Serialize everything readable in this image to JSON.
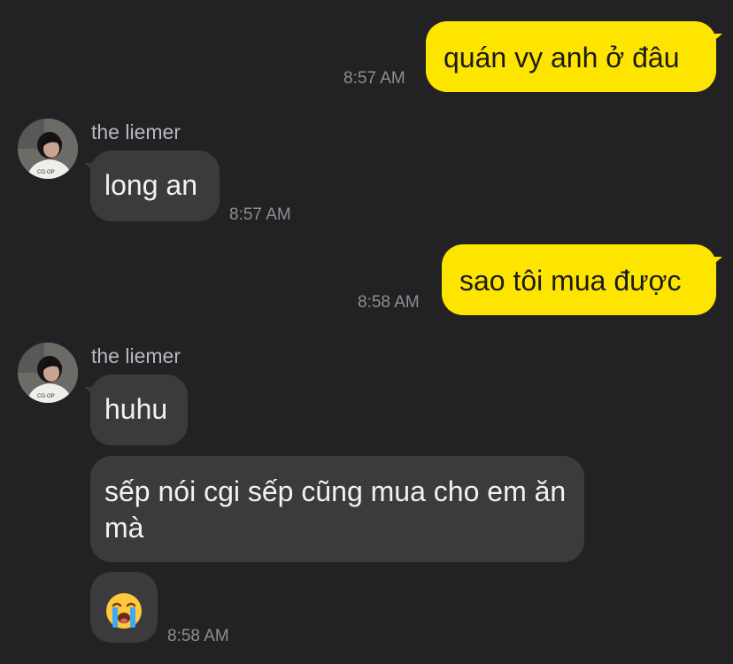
{
  "messages": [
    {
      "type": "sent",
      "text": "quán vy anh ở đâu",
      "time": "8:57 AM"
    },
    {
      "type": "received",
      "sender": "the liemer",
      "text": "long an",
      "time": "8:57 AM"
    },
    {
      "type": "sent",
      "text": "sao tôi mua được",
      "time": "8:58 AM"
    },
    {
      "type": "received",
      "sender": "the liemer",
      "text": "huhu"
    },
    {
      "type": "received",
      "text": "sếp nói cgi sếp cũng mua cho em ăn mà"
    },
    {
      "type": "received",
      "emoji": "loudly-crying-face",
      "time": "8:58 AM"
    }
  ],
  "colors": {
    "background": "#222224",
    "sent_bubble": "#FEE500",
    "received_bubble": "#3b3b3d",
    "timestamp": "#8e8e92"
  }
}
